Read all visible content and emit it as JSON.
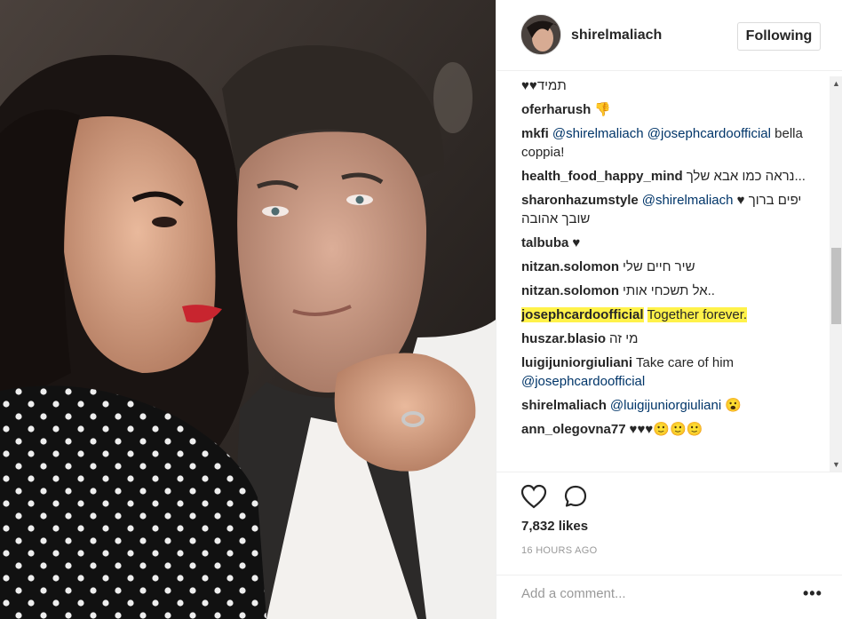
{
  "post": {
    "username": "shirelmaliach",
    "follow_label": "Following",
    "likes": "7,832 likes",
    "time": "16 HOURS AGO",
    "add_comment_placeholder": "Add a comment...",
    "more_label": "•••"
  },
  "comments": [
    {
      "user": "",
      "text": "תמיד♥♥",
      "rtl": true
    },
    {
      "user": "oferharush",
      "text": "👎"
    },
    {
      "user": "mkfi",
      "mentions": [
        "@shirelmaliach",
        "@josephcardoofficial"
      ],
      "text": "bella coppia!"
    },
    {
      "user": "health_food_happy_mind",
      "text": "נראה כמו אבא שלך..."
    },
    {
      "user": "sharonhazumstyle",
      "mentions": [
        "@shirelmaliach"
      ],
      "text": "♥ יפים ברוך שובך אהובה"
    },
    {
      "user": "talbuba",
      "text": "♥"
    },
    {
      "user": "nitzan.solomon",
      "text": "שיר חיים שלי"
    },
    {
      "user": "nitzan.solomon",
      "text": "אל תשכחי אותי.."
    },
    {
      "user": "josephcardoofficial",
      "text": "Together forever."
    },
    {
      "user": "huszar.blasio",
      "text": "מי זה"
    },
    {
      "user": "luigijuniorgiuliani",
      "text": "Take care of him",
      "mentions": [
        "@josephcardoofficial"
      ]
    },
    {
      "user": "shirelmaliach",
      "mentions": [
        "@luigijuniorgiuliani"
      ],
      "text": "😮"
    },
    {
      "user": "ann_olegovna77",
      "text": "♥♥♥🙂🙂🙂"
    }
  ],
  "colors": {
    "mention": "#003569",
    "highlight": "#fff24a",
    "text": "#262626",
    "muted": "#999999"
  },
  "icons": {
    "like": "heart-icon",
    "comment": "comment-bubble-icon",
    "more": "more-dots-icon"
  }
}
